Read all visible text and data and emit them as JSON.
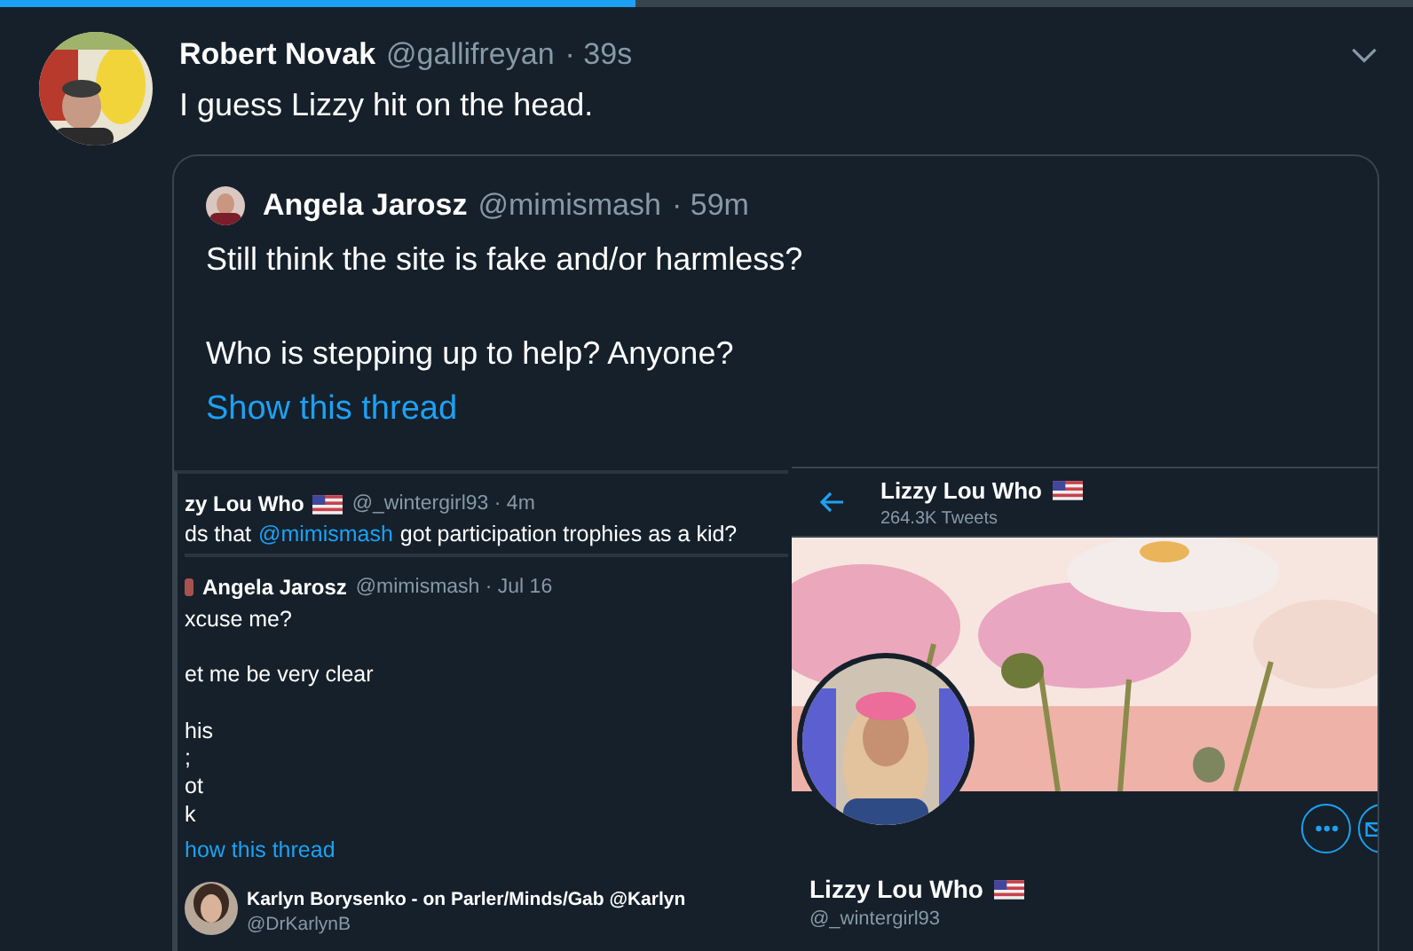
{
  "progress": {
    "level": 0.45
  },
  "tweet": {
    "author": "Robert Novak",
    "handle": "@gallifreyan",
    "time": "· 39s",
    "text": "I guess Lizzy hit on the head."
  },
  "quote": {
    "author": "Angela Jarosz",
    "handle": "@mimismash",
    "time": "· 59m",
    "paragraphs": [
      "Still think the site is fake and/or harmless?",
      "Who is stepping up to help? Anyone?"
    ],
    "thread_link": "Show this thread"
  },
  "media": {
    "thread_shot": {
      "reply": {
        "author": "zy Lou Who",
        "meta": "@_wintergirl93 · 4m",
        "segments": [
          {
            "kind": "text",
            "text": "ds that"
          },
          {
            "kind": "mention",
            "text": "@mimismash"
          },
          {
            "kind": "text",
            "text": "got participation trophies as a kid?"
          }
        ]
      },
      "tweet": {
        "author": "Angela Jarosz",
        "meta": "@mimismash · Jul 16",
        "paragraphs": [
          [
            "xcuse me?"
          ],
          [
            "et me be very clear"
          ],
          [
            "his",
            ";",
            "ot",
            "k"
          ]
        ],
        "thread_link": "how this thread"
      },
      "next": {
        "author": "Karlyn Borysenko - on Parler/Minds/Gab @Karlyn",
        "handle": "@DrKarlynB"
      }
    },
    "profile_shot": {
      "header_name": "Lizzy Lou Who",
      "header_count": "264.3K Tweets",
      "name": "Lizzy Lou Who",
      "handle": "@_wintergirl93"
    }
  }
}
